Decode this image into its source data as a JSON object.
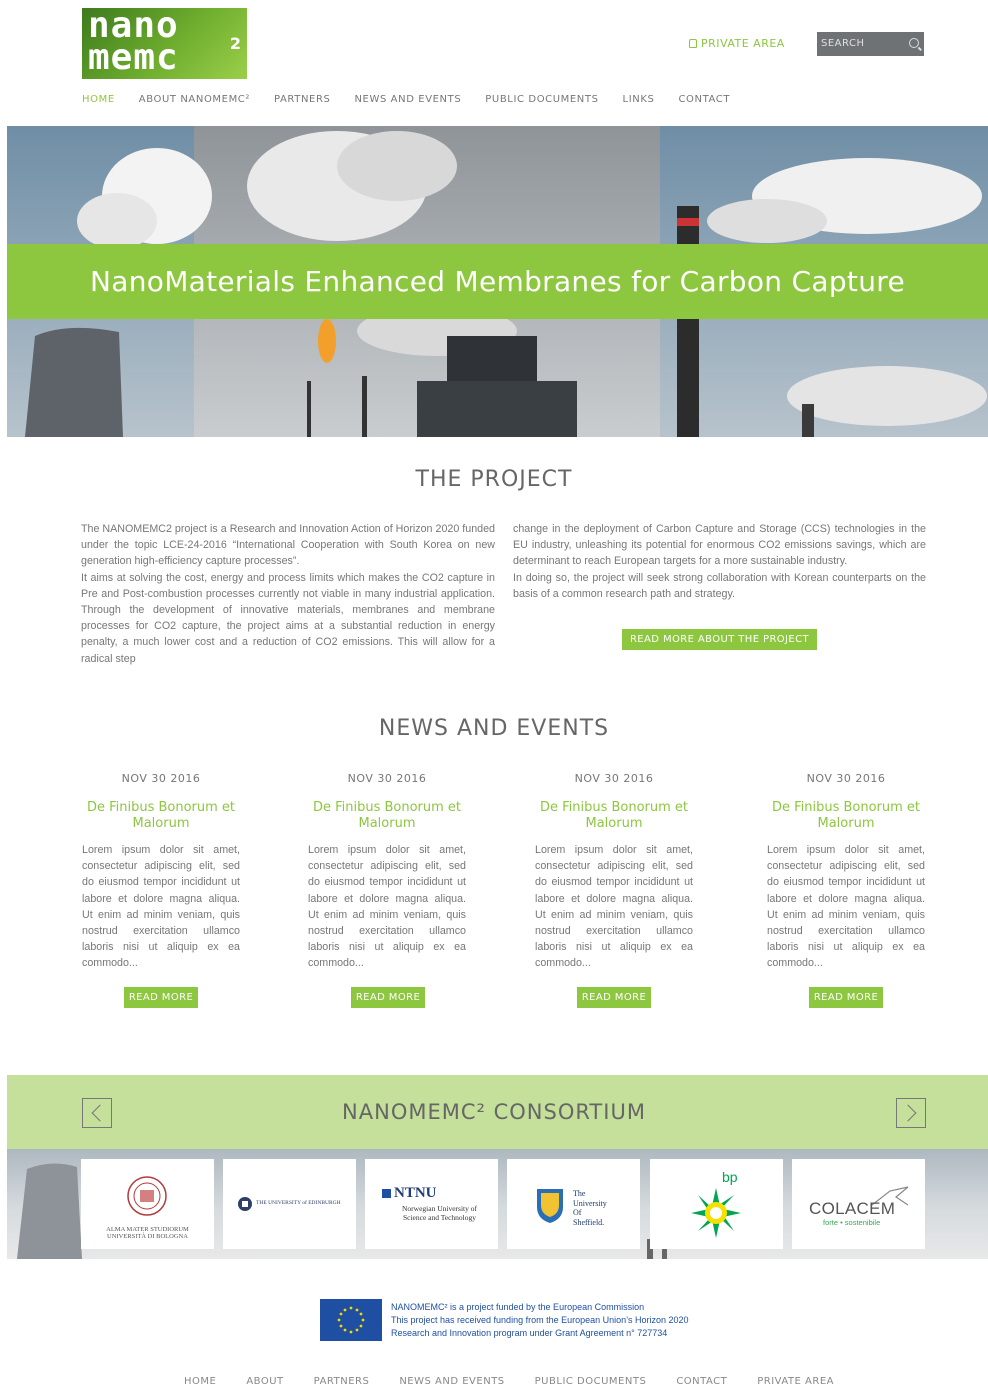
{
  "logo": {
    "line1": "nano",
    "line2": "memc",
    "sup": "2"
  },
  "header": {
    "private_area": "PRIVATE AREA",
    "search_placeholder": "SEARCH"
  },
  "nav": [
    "HOME",
    "ABOUT NANOMEMC²",
    "PARTNERS",
    "NEWS AND EVENTS",
    "PUBLIC DOCUMENTS",
    "LINKS",
    "CONTACT"
  ],
  "hero": {
    "title": "NanoMaterials Enhanced Membranes for Carbon Capture"
  },
  "project": {
    "title": "THE PROJECT",
    "left_p1": "The NANOMEMC2 project is a Research and Innovation Action of Horizon 2020 funded under the topic LCE-24-2016 “International Cooperation with South Korea on new generation high-efficiency capture processes”.",
    "left_p2": "It aims at solving the cost, energy and process limits which makes the CO2 capture in Pre and Post-combustion processes currently not viable in many industrial application. Through the development of innovative materials, membranes and membrane processes for CO2 capture, the project aims at a substantial reduction in energy penalty, a much lower cost and a reduction of CO2 emissions. This will allow for a radical step",
    "right_p1": "change in the deployment of Carbon Capture and Storage (CCS) technologies in the EU industry, unleashing its potential for enormous CO2 emissions savings, which are determinant to reach European targets for a more sustainable industry.",
    "right_p2": "In doing so, the project will seek strong collaboration with Korean counterparts on the basis of a common research path and strategy.",
    "button": "READ MORE ABOUT THE PROJECT"
  },
  "news": {
    "title": "NEWS AND EVENTS",
    "items": [
      {
        "date": "NOV 30 2016",
        "title": "De Finibus Bonorum et Malorum",
        "body": "Lorem ipsum dolor sit amet, consectetur adipiscing elit, sed do eiusmod tempor incididunt ut labore et dolore magna aliqua. Ut enim ad minim veniam, quis nostrud exercitation ullamco laboris nisi ut aliquip ex ea commodo...",
        "button": "READ MORE"
      },
      {
        "date": "NOV 30 2016",
        "title": "De Finibus Bonorum et Malorum",
        "body": "Lorem ipsum dolor sit amet, consectetur adipiscing elit, sed do eiusmod tempor incididunt ut labore et dolore magna aliqua. Ut enim ad minim veniam, quis nostrud exercitation ullamco laboris nisi ut aliquip ex ea commodo...",
        "button": "READ MORE"
      },
      {
        "date": "NOV 30 2016",
        "title": "De Finibus Bonorum et Malorum",
        "body": "Lorem ipsum dolor sit amet, consectetur adipiscing elit, sed do eiusmod tempor incididunt ut labore et dolore magna aliqua. Ut enim ad minim veniam, quis nostrud exercitation ullamco laboris nisi ut aliquip ex ea commodo...",
        "button": "READ MORE"
      },
      {
        "date": "NOV 30 2016",
        "title": "De Finibus Bonorum et Malorum",
        "body": "Lorem ipsum dolor sit amet, consectetur adipiscing elit, sed do eiusmod tempor incididunt ut labore et dolore magna aliqua. Ut enim ad minim veniam, quis nostrud exercitation ullamco laboris nisi ut aliquip ex ea commodo...",
        "button": "READ MORE"
      }
    ]
  },
  "consortium": {
    "title": "NANOMEMC² CONSORTIUM",
    "partners": {
      "bologna": {
        "line1": "ALMA MATER STUDIORUM",
        "line2": "UNIVERSITÀ DI BOLOGNA"
      },
      "edinburgh": {
        "name": "THE UNIVERSITY of EDINBURGH"
      },
      "ntnu": {
        "name": "NTNU",
        "line1": "Norwegian University of",
        "line2": "Science and Technology"
      },
      "sheffield": {
        "line1": "The",
        "line2": "University",
        "line3": "Of",
        "line4": "Sheffield."
      },
      "bp": {
        "name": "bp"
      },
      "colacem": {
        "name": "COLACEM",
        "tagline": "forte • sostenibile"
      }
    }
  },
  "footer": {
    "eu_line1": "NANOMEMC² is a project funded by the European Commission",
    "eu_line2": "This project has received funding from the European Union’s Horizon 2020",
    "eu_line3": "Research and Innovation program under Grant Agreement n° 727734",
    "nav": [
      "HOME",
      "ABOUT",
      "PARTNERS",
      "NEWS AND EVENTS",
      "PUBLIC DOCUMENTS",
      "CONTACT",
      "PRIVATE AREA"
    ]
  },
  "colors": {
    "accent": "#8dc63f",
    "accent_light": "#c4e09a",
    "text": "#777777",
    "eu_blue": "#1f4fa3"
  }
}
